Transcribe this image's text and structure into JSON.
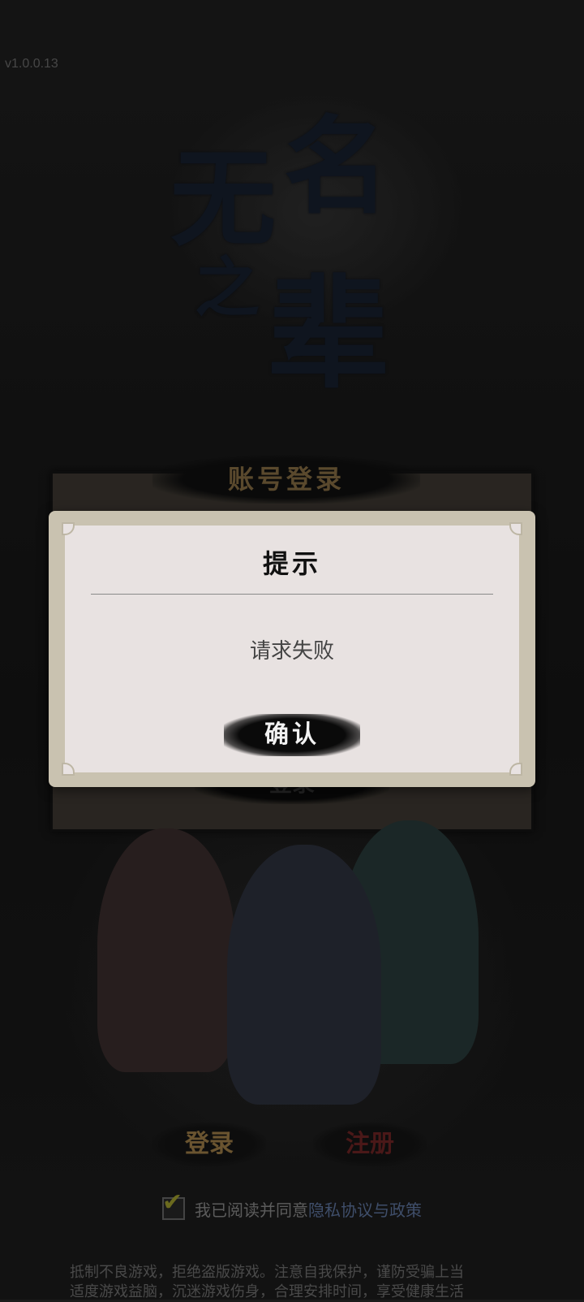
{
  "app": {
    "version": "v1.0.0.13",
    "logo_chars": [
      "无",
      "名",
      "之",
      "辈"
    ]
  },
  "login_panel": {
    "title": "账号登录",
    "button_label": "登录"
  },
  "dialog": {
    "title": "提示",
    "message": "请求失败",
    "confirm_label": "确认"
  },
  "bottom": {
    "login_label": "登录",
    "register_label": "注册",
    "agreement_prefix": "我已阅读并同意",
    "agreement_link": "隐私协议与政策",
    "agreement_checked": true
  },
  "health_notice": {
    "line1": "抵制不良游戏，拒绝盗版游戏。注意自我保护，谨防受骗上当",
    "line2": "适度游戏益脑，沉迷游戏伤身，合理安排时间，享受健康生活"
  },
  "colors": {
    "background": "#1b1b1b",
    "dialog_frame": "#c9c2b0",
    "dialog_body": "#e8e2e1",
    "link": "#3f4e6a"
  },
  "icons": {
    "checkbox": "check-icon"
  }
}
